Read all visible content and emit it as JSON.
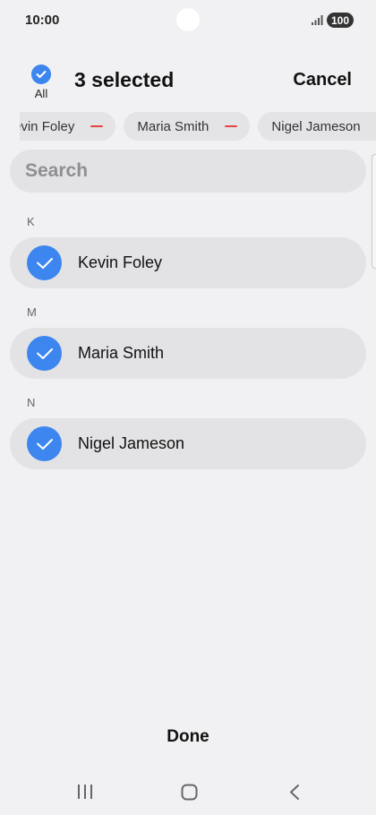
{
  "status_bar": {
    "time": "10:00",
    "battery": "100",
    "icons": [
      "signal-icon"
    ]
  },
  "header": {
    "all_label": "All",
    "selected_count": "3 selected",
    "cancel_label": "Cancel"
  },
  "chips": [
    {
      "label": "Kevin Foley"
    },
    {
      "label": "Maria Smith"
    },
    {
      "label": "Nigel Jameson"
    }
  ],
  "search": {
    "placeholder": "Search"
  },
  "sections": [
    {
      "letter": "K",
      "contact": "Kevin Foley"
    },
    {
      "letter": "M",
      "contact": "Maria Smith"
    },
    {
      "letter": "N",
      "contact": "Nigel Jameson"
    }
  ],
  "footer": {
    "done_label": "Done"
  },
  "colors": {
    "accent": "#3d86f0",
    "remove": "#e54444",
    "background": "#f1f1f3",
    "row": "#e3e3e6"
  }
}
